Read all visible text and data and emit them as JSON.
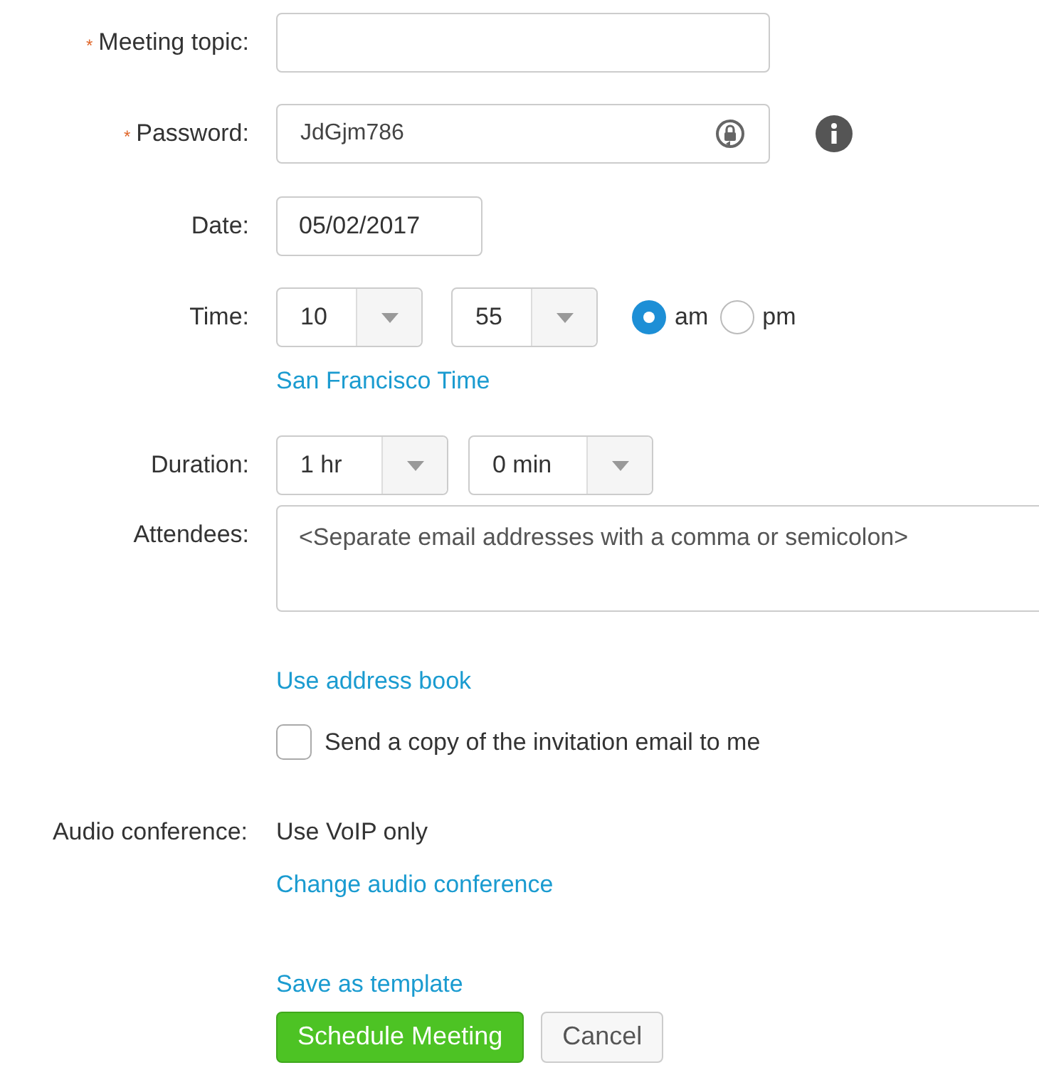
{
  "meeting_topic": {
    "required_mark": "*",
    "label": "Meeting topic:"
  },
  "password": {
    "required_mark": "*",
    "label": "Password:",
    "value": "JdGjm786"
  },
  "date": {
    "label": "Date:",
    "value": "05/02/2017"
  },
  "time": {
    "label": "Time:",
    "hour": "10",
    "minute": "55",
    "meridiem": [
      {
        "label": "am",
        "selected": true
      },
      {
        "label": "pm",
        "selected": false
      }
    ],
    "timezone_link": "San Francisco Time"
  },
  "duration": {
    "label": "Duration:",
    "hours": "1 hr",
    "minutes": "0 min"
  },
  "attendees": {
    "label": "Attendees:",
    "placeholder": "<Separate email addresses with a comma or semicolon>",
    "link": "Use address book",
    "copy_checkbox": {
      "label": "Send a copy of the invitation email to me",
      "checked": false
    }
  },
  "audio_conference": {
    "label": "Audio conference:",
    "value": "Use VoIP only",
    "link": "Change audio conference"
  },
  "save_template_link": "Save as template",
  "buttons": [
    {
      "label": "Schedule Meeting",
      "kind": "primary"
    },
    {
      "label": "Cancel",
      "kind": "secondary"
    }
  ]
}
